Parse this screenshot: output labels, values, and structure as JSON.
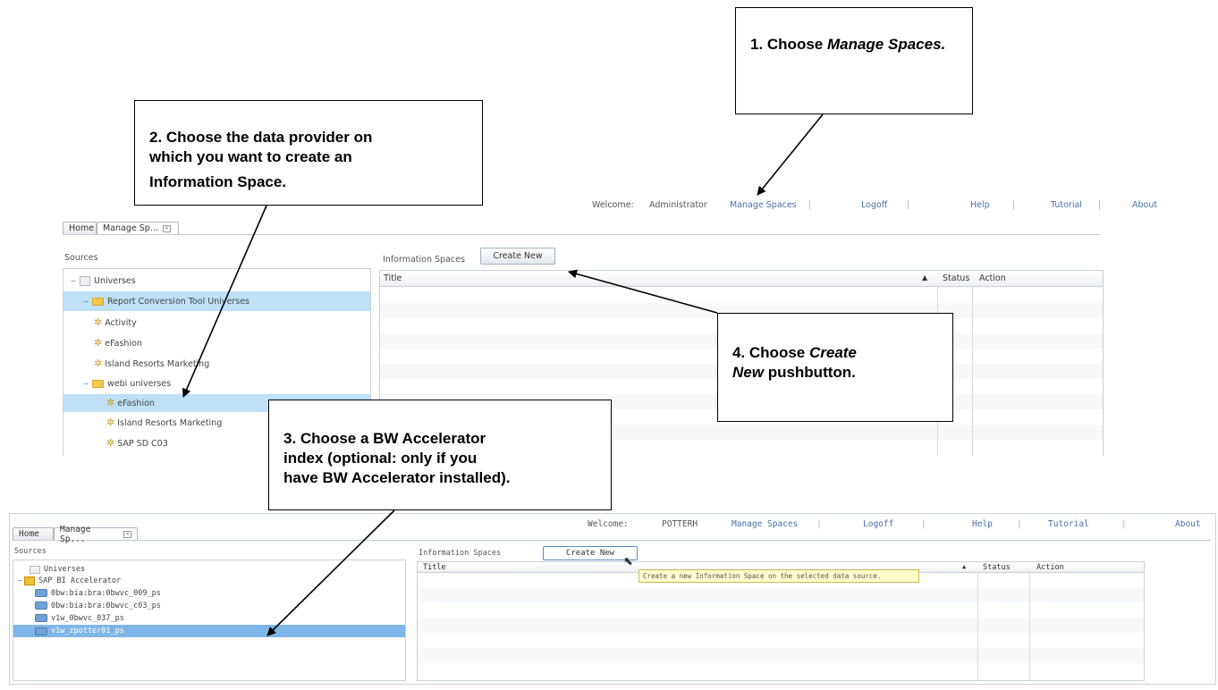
{
  "callouts": {
    "c1": {
      "pre": "1. Choose ",
      "em": "Manage Spaces.",
      "post": ""
    },
    "c2": {
      "line1": "2. Choose the data provider on",
      "line2": "which you want to create an",
      "line3": "Information Space."
    },
    "c3": {
      "line1": "3. Choose a BW Accelerator",
      "line2": "index (optional: only if you",
      "line3": "have BW Accelerator installed)."
    },
    "c4": {
      "pre": "4. Choose ",
      "em1": "Create",
      "em2": "New",
      "post": " pushbutton."
    }
  },
  "top": {
    "nav": {
      "welcome": "Welcome:",
      "user": "Administrator",
      "manage": "Manage Spaces",
      "logoff": "Logoff",
      "help": "Help",
      "tutorial": "Tutorial",
      "about": "About",
      "sep": "|"
    },
    "tabs": {
      "home": "Home",
      "manage": "Manage Sp..."
    },
    "sources_label": "Sources",
    "tree": [
      {
        "label": "Universes"
      },
      {
        "label": "Report Conversion Tool Universes"
      },
      {
        "label": "Activity"
      },
      {
        "label": "eFashion"
      },
      {
        "label": "Island Resorts Marketing"
      },
      {
        "label": "webi universes"
      },
      {
        "label": "eFashion"
      },
      {
        "label": "Island Resorts Marketing"
      },
      {
        "label": "SAP SD C03"
      }
    ],
    "info_label": "Information Spaces",
    "create_new": "Create New",
    "grid": {
      "title": "Title",
      "status": "Status",
      "action": "Action",
      "sort": "▲"
    }
  },
  "bottom": {
    "nav": {
      "welcome": "Welcome:",
      "user": "POTTERH",
      "manage": "Manage Spaces",
      "logoff": "Logoff",
      "help": "Help",
      "tutorial": "Tutorial",
      "about": "About",
      "sep": "|"
    },
    "tabs": {
      "home": "Home",
      "manage": "Manage Sp..."
    },
    "sources_label": "Sources",
    "tree": [
      {
        "label": "Universes"
      },
      {
        "label": "SAP BI Accelerator"
      },
      {
        "label": "0bw:bia:bra:0bwvc_009_ps"
      },
      {
        "label": "0bw:bia:bra:0bwvc_c03_ps"
      },
      {
        "label": "v1w_0bwvc_037_ps"
      },
      {
        "label": "v1w_zpotter01_ps"
      }
    ],
    "info_label": "Information Spaces",
    "create_new": "Create New",
    "tooltip": "Create a new Information Space on the selected data source.",
    "grid": {
      "title": "Title",
      "status": "Status",
      "action": "Action",
      "sort": "▲"
    }
  }
}
